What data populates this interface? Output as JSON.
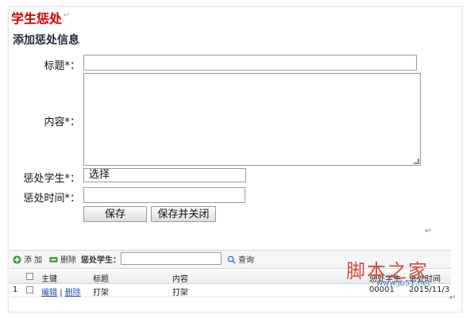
{
  "doc": {
    "title": "学生惩处",
    "return_mark": "↵"
  },
  "form": {
    "section_title": "添加惩处信息",
    "title_label": "标题*：",
    "content_label": "内容*：",
    "student_label": "惩处学生*：",
    "student_value": "选择",
    "time_label": "惩处时间*：",
    "title_value": "",
    "content_value": "",
    "time_value": "",
    "save_label": "保存",
    "save_close_label": "保存并关闭"
  },
  "toolbar": {
    "add_label": "添 加",
    "delete_label": "删除",
    "filter_label": "惩处学生：",
    "filter_value": "",
    "query_label": "查询"
  },
  "grid": {
    "columns": [
      "主键",
      "标题",
      "内容",
      "惩处学生",
      "惩处时间"
    ],
    "rows": [
      {
        "index": "1",
        "edit": "编辑",
        "sep": "|",
        "delete": "删除",
        "title": "打架",
        "content": "打架",
        "student": "00001",
        "time": "2015/11/3"
      }
    ]
  },
  "watermark": {
    "text": "脚本之家",
    "url": "www.jb51.net"
  },
  "colors": {
    "title_red": "#cc0000",
    "link_blue": "#1a4fb3",
    "add_green": "#2e9a2e"
  }
}
